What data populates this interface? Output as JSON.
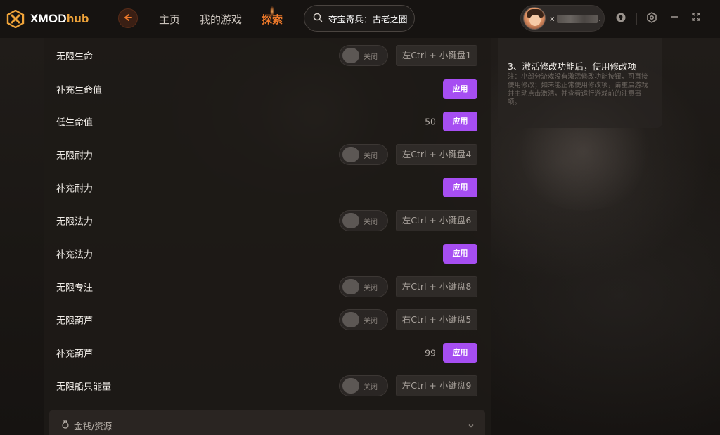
{
  "app": {
    "logo_main": "XMOD",
    "logo_accent": "hub",
    "accent_color": "#f07a2a",
    "button_color": "#a64ef2"
  },
  "nav": {
    "back_icon": "arrow-left-icon",
    "items": [
      {
        "label": "主页",
        "active": false
      },
      {
        "label": "我的游戏",
        "active": false
      },
      {
        "label": "探索",
        "active": true
      }
    ]
  },
  "search": {
    "value": "夺宝奇兵：古老之圈",
    "icon": "search-icon"
  },
  "user": {
    "name_visible": "x",
    "name_suffix": "."
  },
  "window_controls": [
    "notification-icon",
    "settings-icon",
    "minimize-icon",
    "fullscreen-icon"
  ],
  "cheats": [
    {
      "label": "无限生命",
      "type": "toggle",
      "state": "关闭",
      "hotkey": "左Ctrl + 小键盘1"
    },
    {
      "label": "补充生命值",
      "type": "apply",
      "button": "应用"
    },
    {
      "label": "低生命值",
      "type": "value_apply",
      "value": "50",
      "button": "应用"
    },
    {
      "label": "无限耐力",
      "type": "toggle",
      "state": "关闭",
      "hotkey": "左Ctrl + 小键盘4"
    },
    {
      "label": "补充耐力",
      "type": "apply",
      "button": "应用"
    },
    {
      "label": "无限法力",
      "type": "toggle",
      "state": "关闭",
      "hotkey": "左Ctrl + 小键盘6"
    },
    {
      "label": "补充法力",
      "type": "apply",
      "button": "应用"
    },
    {
      "label": "无限专注",
      "type": "toggle",
      "state": "关闭",
      "hotkey": "左Ctrl + 小键盘8"
    },
    {
      "label": "无限葫芦",
      "type": "toggle",
      "state": "关闭",
      "hotkey": "右Ctrl + 小键盘5"
    },
    {
      "label": "补充葫芦",
      "type": "value_apply",
      "value": "99",
      "button": "应用"
    },
    {
      "label": "无限船只能量",
      "type": "toggle",
      "state": "关闭",
      "hotkey": "左Ctrl + 小键盘9"
    }
  ],
  "section": {
    "title": "金钱/资源",
    "icon": "money-bag-icon"
  },
  "info": {
    "step": "3、激活修改功能后，使用修改项",
    "note": "注：小部分游戏没有激活修改功能按钮，可直接使用修改；如未能正常使用修改项，请重启游戏并主动点击激活，并查看运行游戏前的注意事项。"
  }
}
